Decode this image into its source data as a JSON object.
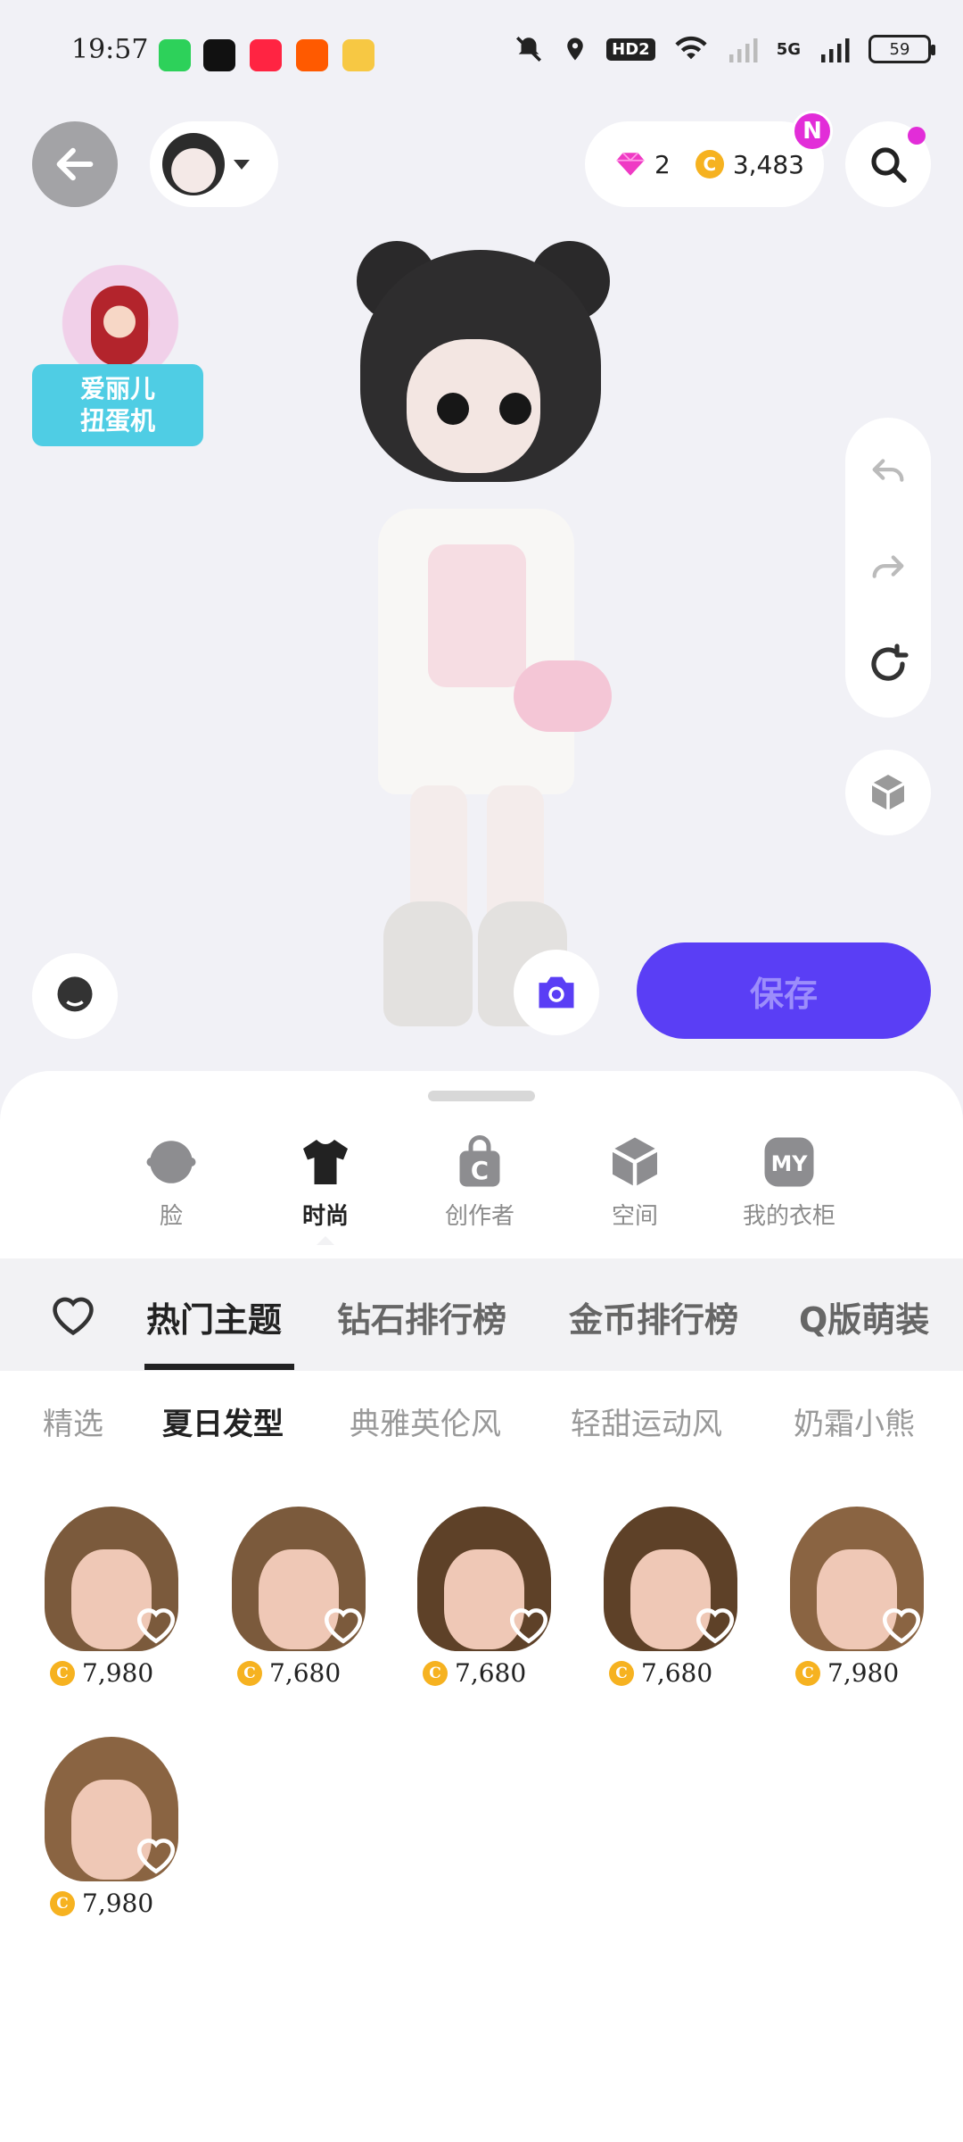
{
  "status_bar": {
    "time": "19:57",
    "battery": "59",
    "network": "5G",
    "hd_label": "HD2"
  },
  "header": {
    "gems": "2",
    "coins": "3,483",
    "notification_badge": "N"
  },
  "promo": {
    "line1": "爱丽儿",
    "line2": "扭蛋机"
  },
  "actions": {
    "save_label": "保存"
  },
  "categories": [
    {
      "label": "脸",
      "icon": "face-icon",
      "active": false
    },
    {
      "label": "时尚",
      "icon": "tshirt-icon",
      "active": true
    },
    {
      "label": "创作者",
      "icon": "creator-bag-icon",
      "active": false
    },
    {
      "label": "空间",
      "icon": "space-cube-icon",
      "active": false
    },
    {
      "label": "我的衣柜",
      "icon": "my-closet-icon",
      "active": false
    }
  ],
  "my_badge": "MY",
  "creator_badge": "C",
  "tabs": [
    {
      "label": "热门主题",
      "active": true
    },
    {
      "label": "钻石排行榜",
      "active": false
    },
    {
      "label": "金币排行榜",
      "active": false
    },
    {
      "label": "Q版萌装",
      "active": false
    }
  ],
  "subtabs": [
    {
      "label": "精选",
      "active": false
    },
    {
      "label": "夏日发型",
      "active": true
    },
    {
      "label": "典雅英伦风",
      "active": false
    },
    {
      "label": "轻甜运动风",
      "active": false
    },
    {
      "label": "奶霜小熊",
      "active": false
    }
  ],
  "items": [
    {
      "price": "7,980",
      "hair_color": "#7b5a3c"
    },
    {
      "price": "7,680",
      "hair_color": "#7b5a3c"
    },
    {
      "price": "7,680",
      "hair_color": "#5e4128"
    },
    {
      "price": "7,680",
      "hair_color": "#5e4128"
    },
    {
      "price": "7,980",
      "hair_color": "#8a6442"
    },
    {
      "price": "7,980",
      "hair_color": "#8a6442"
    }
  ],
  "colors": {
    "accent_purple": "#5a3ef5",
    "promo_cyan": "#4fcde4",
    "coin_gold": "#f6b220",
    "badge_magenta": "#e22dd8"
  }
}
